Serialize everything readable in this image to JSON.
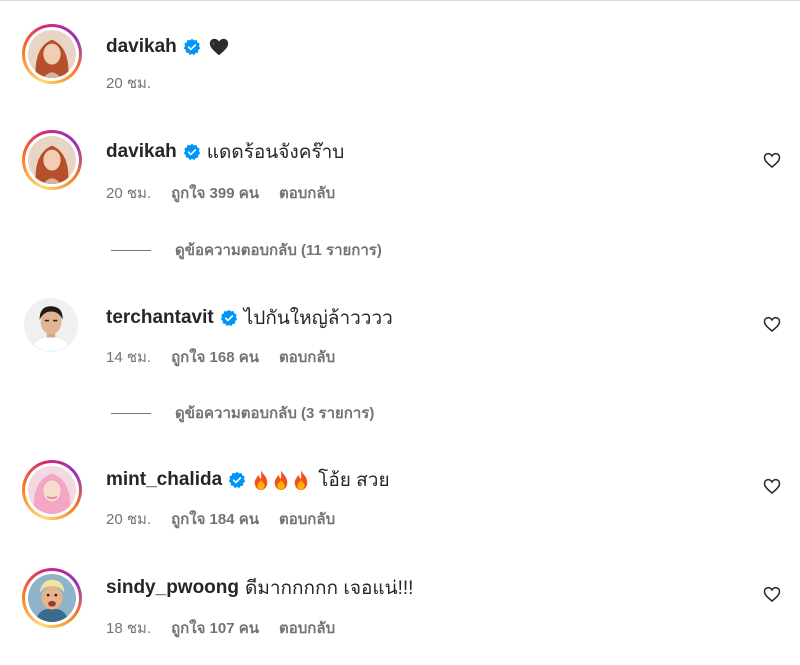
{
  "colors": {
    "verified": "#0095f6",
    "meta": "#737373",
    "text": "#262626"
  },
  "comments": [
    {
      "username": "davikah",
      "verified": true,
      "text": "🖤",
      "time": "20 ชม.",
      "likes": "",
      "reply": "",
      "avatar": "red-hair-woman-avatar",
      "has_story_ring": true
    },
    {
      "username": "davikah",
      "verified": true,
      "text": "แดดร้อนจังคร๊าบ",
      "time": "20 ชม.",
      "likes": "ถูกใจ 399 คน",
      "reply": "ตอบกลับ",
      "avatar": "red-hair-woman-avatar",
      "has_story_ring": true,
      "view_replies": "ดูข้อความตอบกลับ (11 รายการ)"
    },
    {
      "username": "terchantavit",
      "verified": true,
      "text": "ไปกันใหญ่ล้าวววว",
      "time": "14 ชม.",
      "likes": "ถูกใจ 168 คน",
      "reply": "ตอบกลับ",
      "avatar": "man-avatar",
      "has_story_ring": false,
      "view_replies": "ดูข้อความตอบกลับ (3 รายการ)"
    },
    {
      "username": "mint_chalida",
      "verified": true,
      "text": "โอ้ย สวย",
      "emoji_prefix": "fire-fire-fire",
      "time": "20 ชม.",
      "likes": "ถูกใจ 184 คน",
      "reply": "ตอบกลับ",
      "avatar": "pink-hair-woman-avatar",
      "has_story_ring": true
    },
    {
      "username": "sindy_pwoong",
      "verified": false,
      "text": "ดีมากกกกก เจอแน่!!!",
      "time": "18 ชม.",
      "likes": "ถูกใจ 107 คน",
      "reply": "ตอบกลับ",
      "avatar": "blonde-man-avatar",
      "has_story_ring": true
    }
  ]
}
